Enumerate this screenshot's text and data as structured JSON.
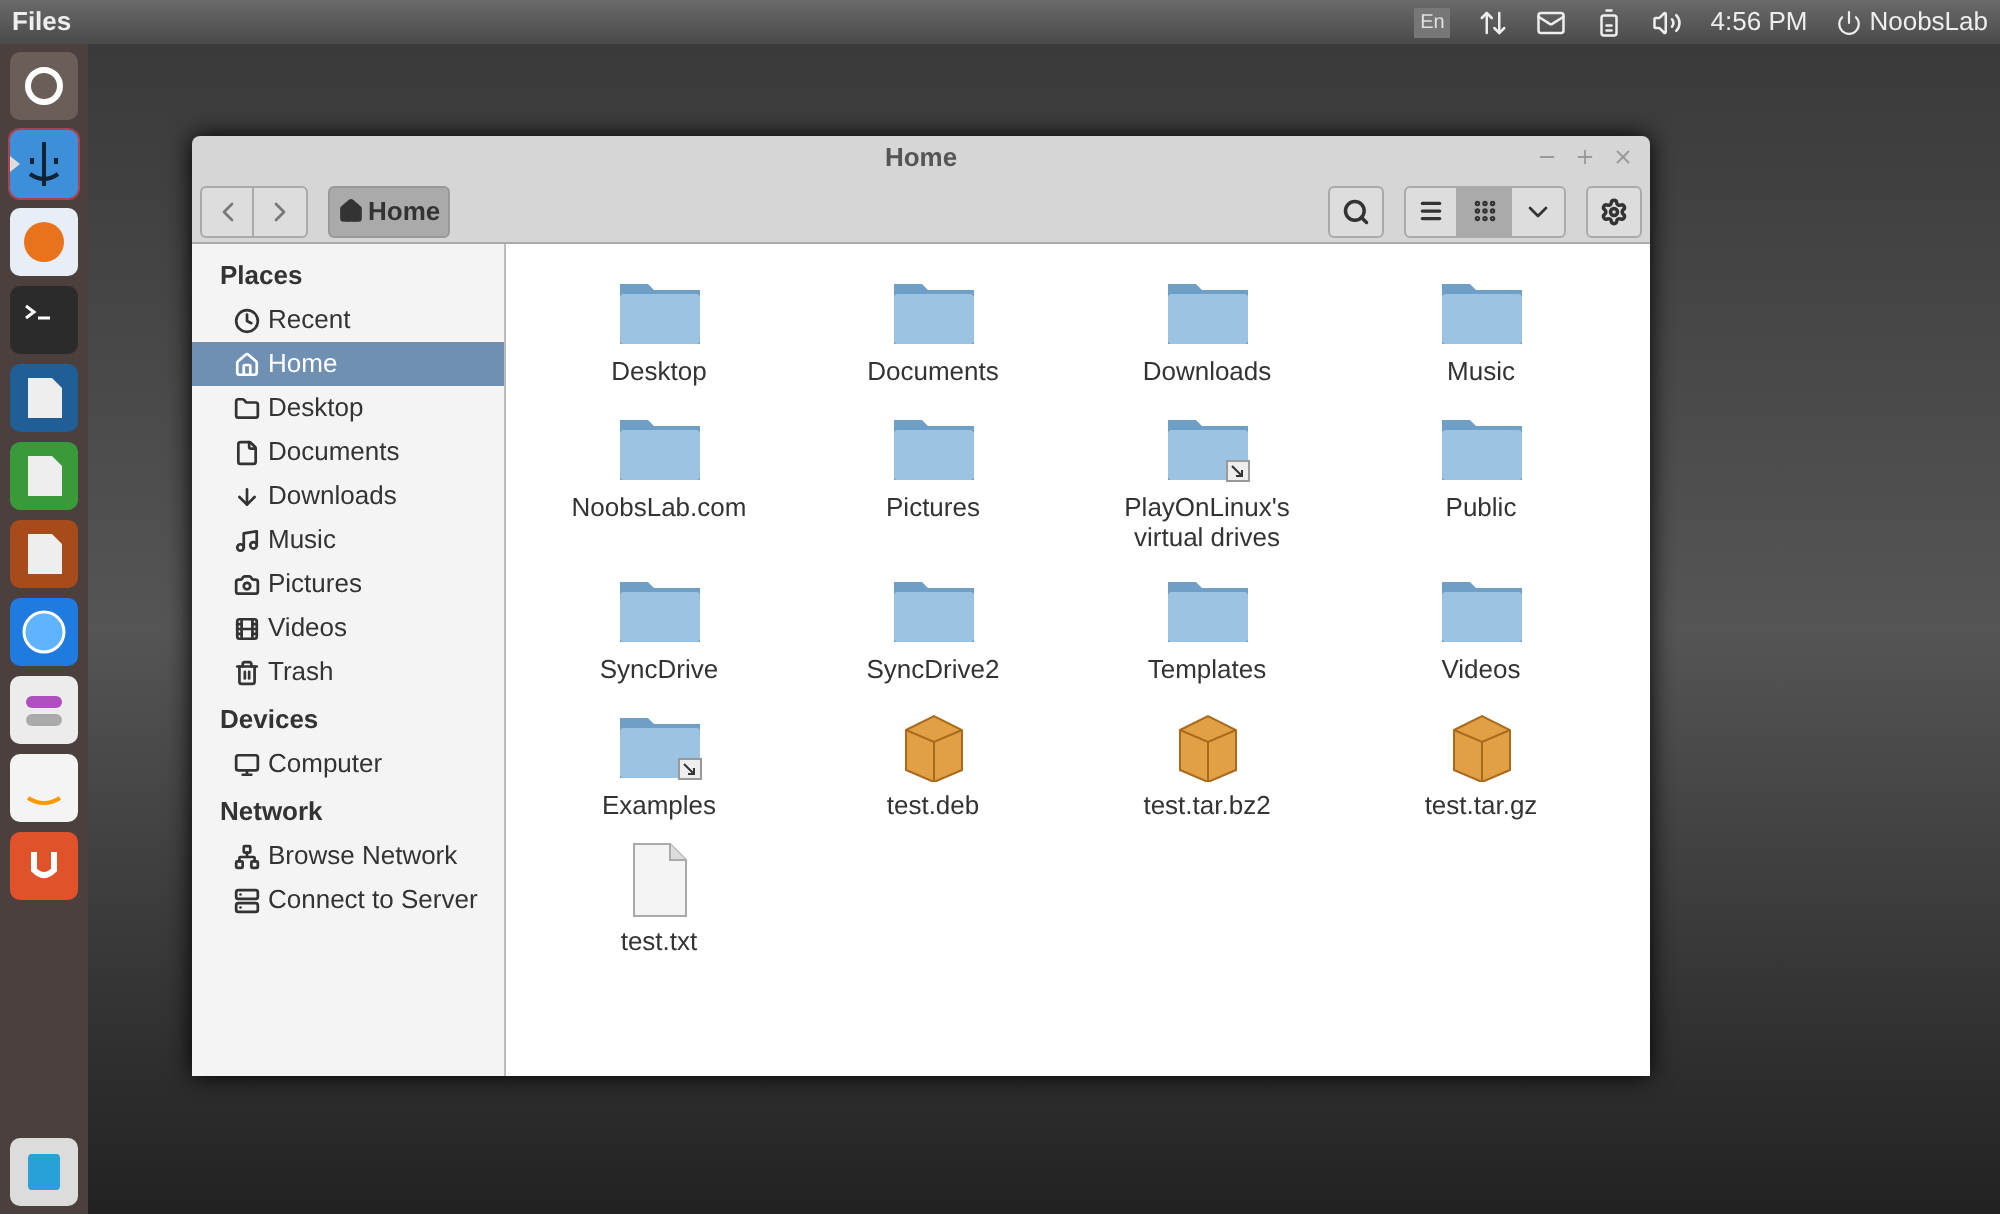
{
  "top_bar": {
    "app_title": "Files",
    "keyboard": "En",
    "time": "4:56 PM",
    "user": "NoobsLab"
  },
  "launcher": [
    {
      "kind": "ubuntu",
      "selected": false
    },
    {
      "kind": "finder",
      "selected": true
    },
    {
      "kind": "firefox",
      "selected": false
    },
    {
      "kind": "terminal",
      "selected": false
    },
    {
      "kind": "writer",
      "selected": false
    },
    {
      "kind": "calc",
      "selected": false
    },
    {
      "kind": "impress",
      "selected": false
    },
    {
      "kind": "appstore",
      "selected": false
    },
    {
      "kind": "settings",
      "selected": false
    },
    {
      "kind": "amazon",
      "selected": false
    },
    {
      "kind": "ubuntuone",
      "selected": false
    },
    {
      "kind": "workspace",
      "selected": false
    }
  ],
  "window": {
    "title": "Home"
  },
  "toolbar": {
    "breadcrumb": "Home",
    "views": [
      {
        "kind": "list",
        "selected": false
      },
      {
        "kind": "grid",
        "selected": true
      }
    ]
  },
  "sidebar": [
    {
      "heading": "Places",
      "items": [
        {
          "label": "Recent",
          "kind": "recent",
          "selected": false
        },
        {
          "label": "Home",
          "kind": "home",
          "selected": true
        },
        {
          "label": "Desktop",
          "kind": "folder",
          "selected": false
        },
        {
          "label": "Documents",
          "kind": "document",
          "selected": false
        },
        {
          "label": "Downloads",
          "kind": "download",
          "selected": false
        },
        {
          "label": "Music",
          "kind": "music",
          "selected": false
        },
        {
          "label": "Pictures",
          "kind": "pictures",
          "selected": false
        },
        {
          "label": "Videos",
          "kind": "videos",
          "selected": false
        },
        {
          "label": "Trash",
          "kind": "trash",
          "selected": false
        }
      ]
    },
    {
      "heading": "Devices",
      "items": [
        {
          "label": "Computer",
          "kind": "computer",
          "selected": false
        }
      ]
    },
    {
      "heading": "Network",
      "items": [
        {
          "label": "Browse Network",
          "kind": "network",
          "selected": false
        },
        {
          "label": "Connect to Server",
          "kind": "server",
          "selected": false
        }
      ]
    }
  ],
  "files": [
    {
      "name": "Desktop",
      "kind": "folder",
      "link": false
    },
    {
      "name": "Documents",
      "kind": "folder",
      "link": false
    },
    {
      "name": "Downloads",
      "kind": "folder",
      "link": false
    },
    {
      "name": "Music",
      "kind": "folder",
      "link": false
    },
    {
      "name": "NoobsLab.com",
      "kind": "folder",
      "link": false
    },
    {
      "name": "Pictures",
      "kind": "folder",
      "link": false
    },
    {
      "name": "PlayOnLinux's virtual drives",
      "kind": "folder",
      "link": true
    },
    {
      "name": "Public",
      "kind": "folder",
      "link": false
    },
    {
      "name": "SyncDrive",
      "kind": "folder",
      "link": false
    },
    {
      "name": "SyncDrive2",
      "kind": "folder",
      "link": false
    },
    {
      "name": "Templates",
      "kind": "folder",
      "link": false
    },
    {
      "name": "Videos",
      "kind": "folder",
      "link": false
    },
    {
      "name": "Examples",
      "kind": "folder",
      "link": true
    },
    {
      "name": "test.deb",
      "kind": "package",
      "link": false
    },
    {
      "name": "test.tar.bz2",
      "kind": "package",
      "link": false
    },
    {
      "name": "test.tar.gz",
      "kind": "package",
      "link": false
    },
    {
      "name": "test.txt",
      "kind": "text",
      "link": false
    }
  ]
}
